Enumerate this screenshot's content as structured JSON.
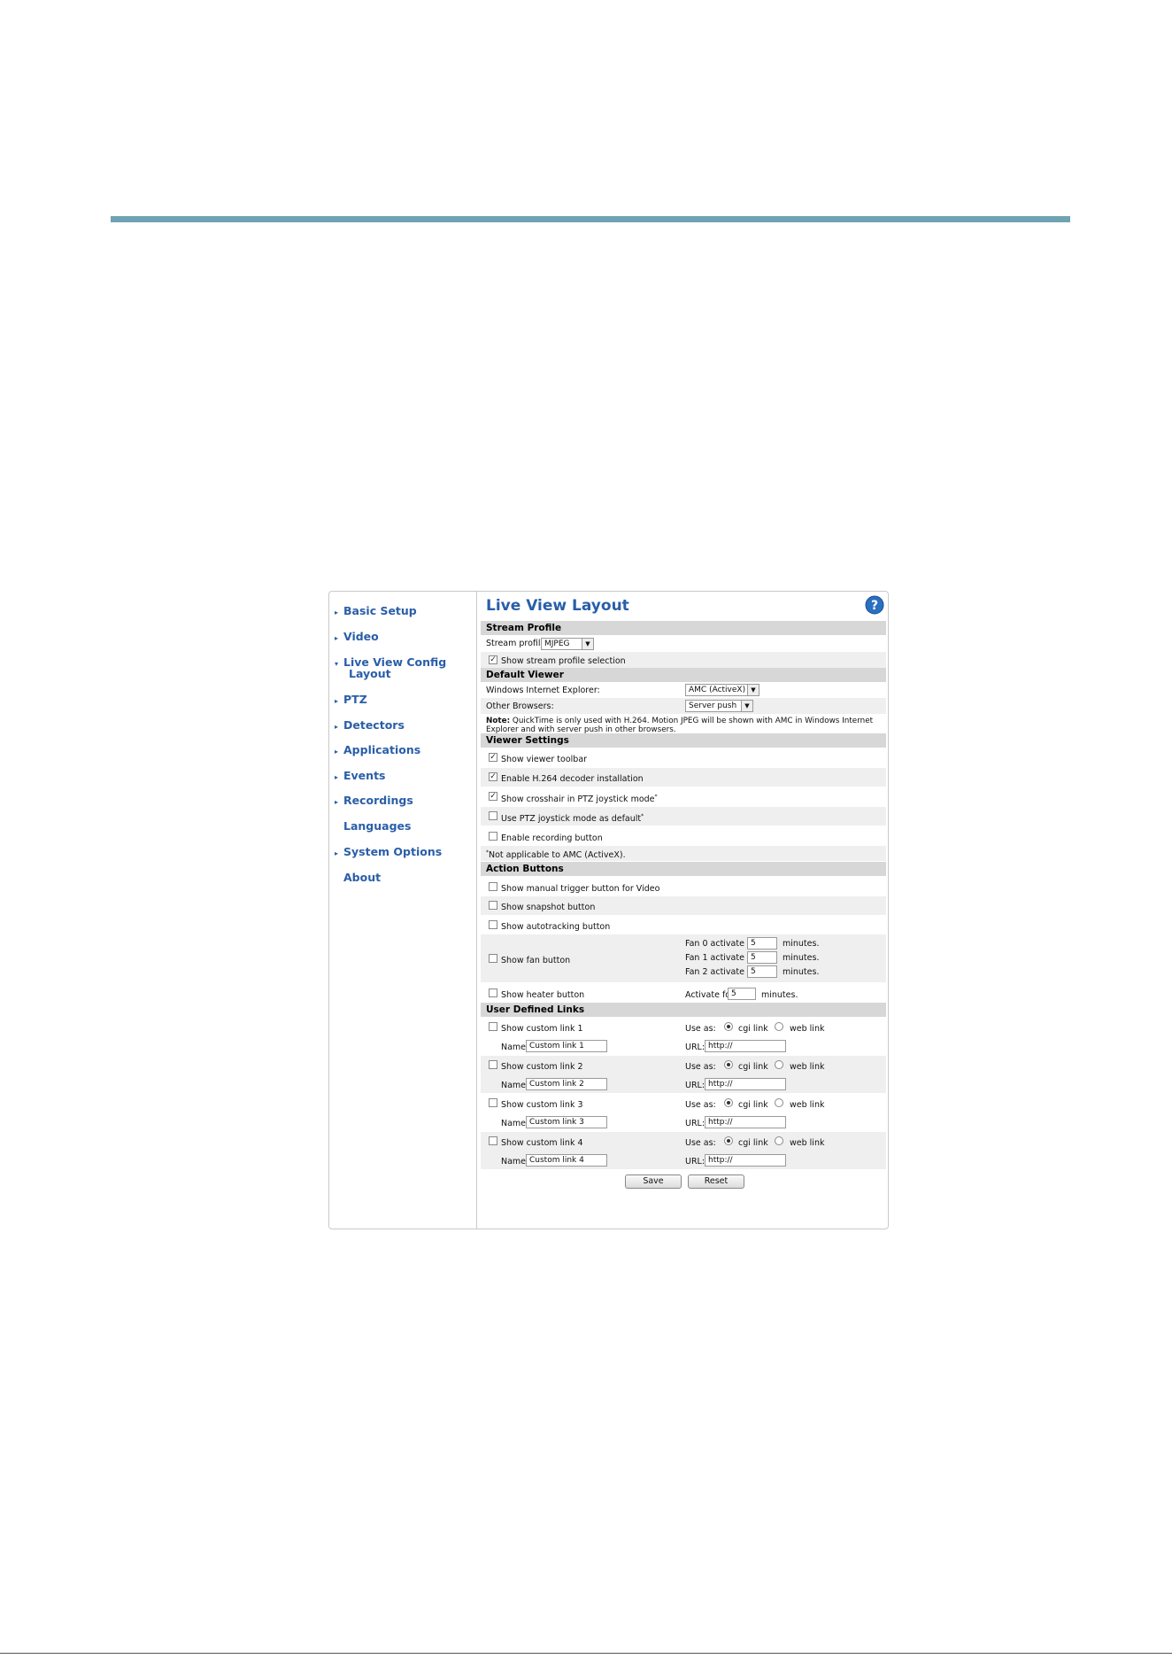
{
  "sidebar": {
    "items": [
      {
        "label": "Basic Setup",
        "arrow": "right"
      },
      {
        "label": "Video",
        "arrow": "right"
      },
      {
        "label": "Live View Config",
        "arrow": "down",
        "sub": "Layout"
      },
      {
        "label": "PTZ",
        "arrow": "right"
      },
      {
        "label": "Detectors",
        "arrow": "right"
      },
      {
        "label": "Applications",
        "arrow": "right"
      },
      {
        "label": "Events",
        "arrow": "right"
      },
      {
        "label": "Recordings",
        "arrow": "right"
      },
      {
        "label": "Languages",
        "arrow": "none"
      },
      {
        "label": "System Options",
        "arrow": "right"
      },
      {
        "label": "About",
        "arrow": "none"
      }
    ]
  },
  "page": {
    "title": "Live View Layout",
    "help_icon": "help-icon"
  },
  "stream_profile": {
    "header": "Stream Profile",
    "profile_label": "Stream profile:",
    "profile_value": "MJPEG",
    "show_selection_label": "Show stream profile selection",
    "show_selection_checked": true
  },
  "default_viewer": {
    "header": "Default Viewer",
    "ie_label": "Windows Internet Explorer:",
    "ie_value": "AMC (ActiveX)",
    "other_label": "Other Browsers:",
    "other_value": "Server push",
    "note_bold": "Note:",
    "note_text": " QuickTime is only used with H.264. Motion JPEG will be shown with AMC in Windows Internet Explorer and with server push in other browsers."
  },
  "viewer_settings": {
    "header": "Viewer Settings",
    "items": [
      {
        "label": "Show viewer toolbar",
        "checked": true,
        "sup": ""
      },
      {
        "label": "Enable H.264 decoder installation",
        "checked": true,
        "sup": ""
      },
      {
        "label": "Show crosshair in PTZ joystick mode",
        "checked": true,
        "sup": "*"
      },
      {
        "label": "Use PTZ joystick mode as default",
        "checked": false,
        "sup": "*"
      },
      {
        "label": "Enable recording button",
        "checked": false,
        "sup": ""
      }
    ],
    "footnote_mark": "*",
    "footnote": "Not applicable to AMC (ActiveX)."
  },
  "action_buttons": {
    "header": "Action Buttons",
    "manual_trigger": "Show manual trigger button for Video",
    "snapshot": "Show snapshot button",
    "autotracking": "Show autotracking button",
    "fan": "Show fan button",
    "fans": [
      {
        "label": "Fan 0 activate for",
        "value": "5",
        "unit": "minutes."
      },
      {
        "label": "Fan 1 activate for",
        "value": "5",
        "unit": "minutes."
      },
      {
        "label": "Fan 2 activate for",
        "value": "5",
        "unit": "minutes."
      }
    ],
    "heater": "Show heater button",
    "heater_label": "Activate for",
    "heater_value": "5",
    "heater_unit": "minutes."
  },
  "user_links": {
    "header": "User Defined Links",
    "use_as": "Use as:",
    "cgi": "cgi link",
    "web": "web link",
    "name_label": "Name:",
    "url_label": "URL:",
    "links": [
      {
        "label": "Show custom link 1",
        "name": "Custom link 1",
        "url": "http://"
      },
      {
        "label": "Show custom link 2",
        "name": "Custom link 2",
        "url": "http://"
      },
      {
        "label": "Show custom link 3",
        "name": "Custom link 3",
        "url": "http://"
      },
      {
        "label": "Show custom link 4",
        "name": "Custom link 4",
        "url": "http://"
      }
    ]
  },
  "buttons": {
    "save": "Save",
    "reset": "Reset"
  }
}
